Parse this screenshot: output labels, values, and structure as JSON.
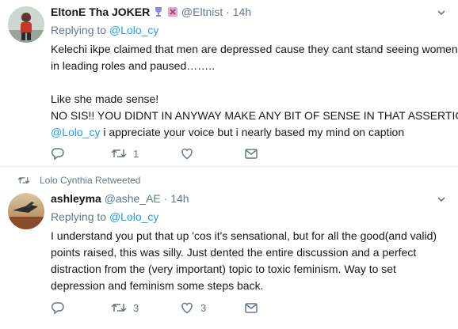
{
  "tweets": [
    {
      "display_name": "EltonE Tha JOKER",
      "handle": "@Eltnist",
      "separator": "·",
      "time": "14h",
      "reply_prefix": "Replying to",
      "reply_to": "@Lolo_cy",
      "body": {
        "line1": "Kelechi ikpe claimed that men are depressed cause they cant stand seeing women",
        "line2": "in leading roles and paused……..",
        "line3": "Like she made sense!",
        "line4": "NO SIS!! YOU DIDNT IN ANYWAY MAKE ANY BIT OF SENSE IN THAT ASSERTION!.",
        "mention": "@Lolo_cy",
        "line5_rest": " i appreciate your voice but i nearly based my mind on caption"
      },
      "reply_count": "",
      "retweet_count": "1",
      "like_count": "",
      "icons": [
        "reply-icon",
        "retweet-icon",
        "like-icon",
        "message-icon"
      ]
    },
    {
      "retweeted_by": "Lolo Cynthia Retweeted",
      "display_name": "ashleyma",
      "handle": "@ashe_AE",
      "separator": "·",
      "time": "14h",
      "reply_prefix": "Replying to",
      "reply_to": "@Lolo_cy",
      "body": {
        "line1": "I understand you put that up 'cos it's sensational, but for all the good(and valid)",
        "line2": "points raised, this was silly. Just dented the entire discussion and a perfect",
        "line3": "distraction from the (very important) topic to toxic feminism. Way to set",
        "line4": "depression and feminism some steps back."
      },
      "reply_count": "",
      "retweet_count": "3",
      "like_count": "3",
      "icons": [
        "reply-icon",
        "retweet-icon",
        "like-icon",
        "message-icon"
      ]
    }
  ],
  "colors": {
    "text": "#14171a",
    "secondary": "#657786",
    "link": "#1da1f2",
    "divider": "#e6ecf0"
  }
}
